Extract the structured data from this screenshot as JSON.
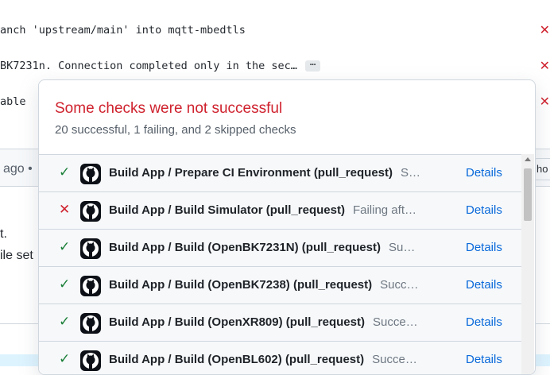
{
  "commits": [
    {
      "text": "anch 'upstream/main' into mqtt-mbedtls",
      "status_icon": "x-icon"
    },
    {
      "text": "BK7231n. Connection completed only in the sec…",
      "ellipsis": "…",
      "status_icon": "x-icon"
    },
    {
      "text": "able",
      "status_icon": "x-icon"
    }
  ],
  "background": {
    "ago": "ago •",
    "right_button": "ho",
    "text_line_1": "t.",
    "text_line_2": "ile set"
  },
  "popover": {
    "title": "Some checks were not successful",
    "summary": "20 successful, 1 failing, and 2 skipped checks",
    "title_color": "#cf222e",
    "checks": [
      {
        "status": "success",
        "icon": "check-icon",
        "avatar": "github-icon",
        "name": "Build App / Prepare CI Environment (pull_request)",
        "status_text": "S…",
        "details": "Details"
      },
      {
        "status": "failure",
        "icon": "x-icon",
        "avatar": "github-icon",
        "name": "Build App / Build Simulator (pull_request)",
        "status_text": "Failing aft…",
        "details": "Details"
      },
      {
        "status": "success",
        "icon": "check-icon",
        "avatar": "github-icon",
        "name": "Build App / Build (OpenBK7231N) (pull_request)",
        "status_text": "Su…",
        "details": "Details"
      },
      {
        "status": "success",
        "icon": "check-icon",
        "avatar": "github-icon",
        "name": "Build App / Build (OpenBK7238) (pull_request)",
        "status_text": "Succ…",
        "details": "Details"
      },
      {
        "status": "success",
        "icon": "check-icon",
        "avatar": "github-icon",
        "name": "Build App / Build (OpenXR809) (pull_request)",
        "status_text": "Succe…",
        "details": "Details"
      },
      {
        "status": "success",
        "icon": "check-icon",
        "avatar": "github-icon",
        "name": "Build App / Build (OpenBL602) (pull_request)",
        "status_text": "Succe…",
        "details": "Details"
      }
    ]
  }
}
